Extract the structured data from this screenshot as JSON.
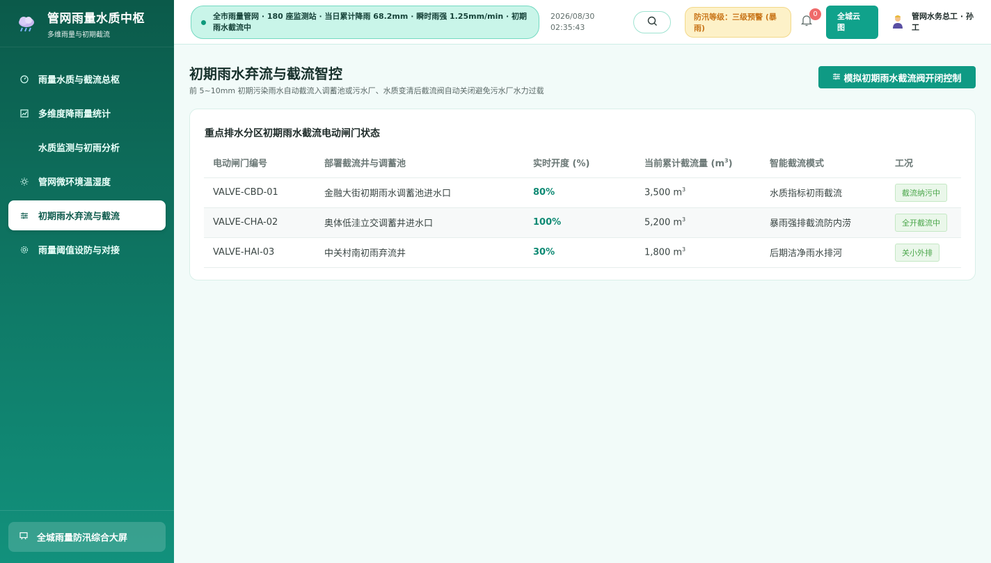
{
  "brand": {
    "title": "管网雨量水质中枢",
    "subtitle": "多维雨量与初期截流"
  },
  "nav": {
    "items": [
      {
        "label": "雨量水质与截流总枢",
        "icon": "gauge-icon"
      },
      {
        "label": "多维度降雨量统计",
        "icon": "chart-icon"
      },
      {
        "label": "水质监测与初雨分析",
        "icon": ""
      },
      {
        "label": "管网微环境温湿度",
        "icon": "sun-icon"
      },
      {
        "label": "初期雨水弃流与截流",
        "icon": "sliders-icon"
      },
      {
        "label": "雨量阈值设防与对接",
        "icon": "gear-icon"
      }
    ],
    "bottom": {
      "label": "全城雨量防汛综合大屏",
      "icon": "screen-icon"
    }
  },
  "header": {
    "ticker": "全市雨量管网 · 180 座监测站 · 当日累计降雨 68.2mm · 瞬时雨强 1.25mm/min · 初期雨水截流中",
    "date": "2026/08/30",
    "time": "02:35:43",
    "alert_level": "防汛等级：三级预警 (暴雨)",
    "notification_count": "0",
    "cloud_button": "全城云图",
    "user": "管网水务总工 · 孙工"
  },
  "page": {
    "title": "初期雨水弃流与截流智控",
    "subtitle": "前 5~10mm 初期污染雨水自动截流入调蓄池或污水厂、水质变清后截流阀自动关闭避免污水厂水力过载",
    "sim_button": "模拟初期雨水截流阀开闭控制"
  },
  "card": {
    "title": "重点排水分区初期雨水截流电动闸门状态",
    "columns": {
      "id": "电动闸门编号",
      "location": "部署截流井与调蓄池",
      "opening": "实时开度 (%)",
      "flow": "当前累计截流量 (m",
      "mode": "智能截流模式",
      "status": "工况"
    },
    "rows": [
      {
        "id": "VALVE-CBD-01",
        "location": "金融大街初期雨水调蓄池进水口",
        "opening": "80%",
        "flow": "3,500 m",
        "mode": "水质指标初雨截流",
        "status": "截流纳污中"
      },
      {
        "id": "VALVE-CHA-02",
        "location": "奥体低洼立交调蓄井进水口",
        "opening": "100%",
        "flow": "5,200 m",
        "mode": "暴雨强排截流防内涝",
        "status": "全开截流中"
      },
      {
        "id": "VALVE-HAI-03",
        "location": "中关村南初雨弃流井",
        "opening": "30%",
        "flow": "1,800 m",
        "mode": "后期洁净雨水排河",
        "status": "关小外排"
      }
    ]
  },
  "colors": {
    "accent": "#0f9a84",
    "sidebar_top": "#0b5a4a",
    "alert_bg": "#fdf1c8",
    "status_green": "#4aa64a"
  }
}
